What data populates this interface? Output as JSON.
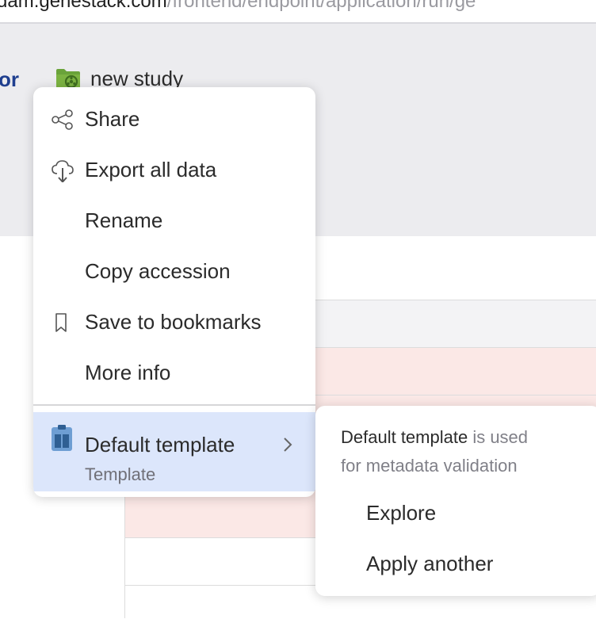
{
  "browser": {
    "url_host": "dam.genestack.com",
    "url_path": "/frontend/endpoint/application/run/ge"
  },
  "header": {
    "crumb_left": "or",
    "study_title": "new study",
    "study_icon": "folder-study-icon"
  },
  "menu": {
    "items": [
      {
        "label": "Share",
        "icon": "share-icon"
      },
      {
        "label": "Export all data",
        "icon": "cloud-download-icon"
      },
      {
        "label": "Rename"
      },
      {
        "label": "Copy accession"
      },
      {
        "label": "Save to bookmarks",
        "icon": "bookmark-icon"
      },
      {
        "label": "More info"
      }
    ],
    "template": {
      "name": "Default template",
      "subtitle": "Template",
      "icon": "template-icon"
    }
  },
  "submenu": {
    "info_name": "Default template",
    "info_rest_1": " is used",
    "info_rest_2": "for metadata validation",
    "options": [
      "Explore",
      "Apply another"
    ]
  },
  "colors": {
    "header_bg": "#ececef",
    "highlight": "#dce6fb",
    "row_pink": "#fbe8e6",
    "folder_green": "#6aa33a",
    "template_blue": "#5b8fc7"
  }
}
